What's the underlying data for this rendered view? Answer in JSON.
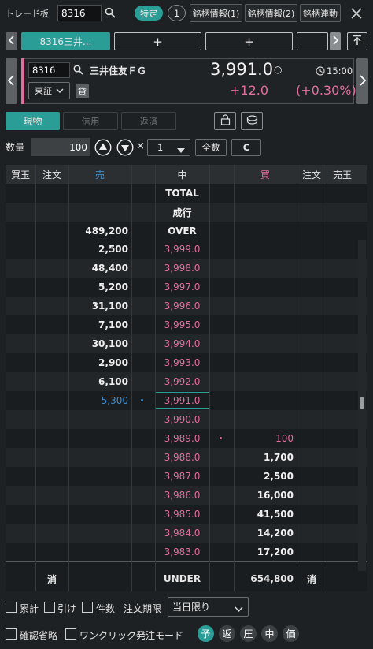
{
  "header": {
    "title": "トレード板",
    "code": "8316",
    "tokutei": "特定",
    "count": "1",
    "info1": "銘柄情報(1)",
    "info2": "銘柄情報(2)",
    "link": "銘柄連動"
  },
  "tabs": {
    "active": "8316三井...",
    "add": "+"
  },
  "stock": {
    "code": "8316",
    "name": "三井住友ＦＧ",
    "market": "東証",
    "kashi": "貸",
    "price": "3,991.0",
    "mark": "○",
    "time": "15:00",
    "change": "+12.0",
    "change_pct": "(+0.30%)"
  },
  "modes": {
    "genbutsu": "現物",
    "shinyo": "信用",
    "hensai": "返済"
  },
  "qty": {
    "label": "数量",
    "value": "100",
    "mult": "×",
    "unit": "1",
    "all": "全数",
    "clear": "C"
  },
  "board": {
    "columns": [
      "買玉",
      "注文",
      "売",
      "中",
      "買",
      "注文",
      "売玉"
    ],
    "top_rows": [
      {
        "sell": "",
        "mid": "TOTAL",
        "buy": ""
      },
      {
        "sell": "",
        "mid": "成行",
        "buy": ""
      },
      {
        "sell": "489,200",
        "mid": "OVER",
        "buy": ""
      }
    ],
    "rows": [
      {
        "sell": "2,500",
        "price": "3,999.0",
        "buy": ""
      },
      {
        "sell": "48,400",
        "price": "3,998.0",
        "buy": ""
      },
      {
        "sell": "5,200",
        "price": "3,997.0",
        "buy": ""
      },
      {
        "sell": "31,100",
        "price": "3,996.0",
        "buy": ""
      },
      {
        "sell": "7,100",
        "price": "3,995.0",
        "buy": ""
      },
      {
        "sell": "30,100",
        "price": "3,994.0",
        "buy": ""
      },
      {
        "sell": "2,900",
        "price": "3,993.0",
        "buy": ""
      },
      {
        "sell": "6,100",
        "price": "3,992.0",
        "buy": ""
      },
      {
        "sell": "5,300",
        "price": "3,991.0",
        "buy": ""
      },
      {
        "sell": "",
        "price": "3,990.0",
        "buy": ""
      },
      {
        "sell": "",
        "price": "3,989.0",
        "buy": "100"
      },
      {
        "sell": "",
        "price": "3,988.0",
        "buy": "1,700"
      },
      {
        "sell": "",
        "price": "3,987.0",
        "buy": "2,500"
      },
      {
        "sell": "",
        "price": "3,986.0",
        "buy": "16,000"
      },
      {
        "sell": "",
        "price": "3,985.0",
        "buy": "41,500"
      },
      {
        "sell": "",
        "price": "3,984.0",
        "buy": "14,200"
      },
      {
        "sell": "",
        "price": "3,983.0",
        "buy": "17,200"
      }
    ],
    "bottom": {
      "cancel_left": "消",
      "mid": "UNDER",
      "buy": "654,800",
      "cancel_right": "消"
    }
  },
  "footer": {
    "cumulative": "累計",
    "hikeru": "引け",
    "kensu": "件数",
    "period_label": "注文期限",
    "period_value": "当日限り",
    "confirm_skip": "確認省略",
    "one_click": "ワンクリック発注モード",
    "circles": [
      "予",
      "返",
      "圧",
      "中",
      "価"
    ]
  },
  "colors": {
    "accent": "#2a9d96",
    "up": "#e06f9d",
    "sell_blue": "#3b8fd3"
  }
}
